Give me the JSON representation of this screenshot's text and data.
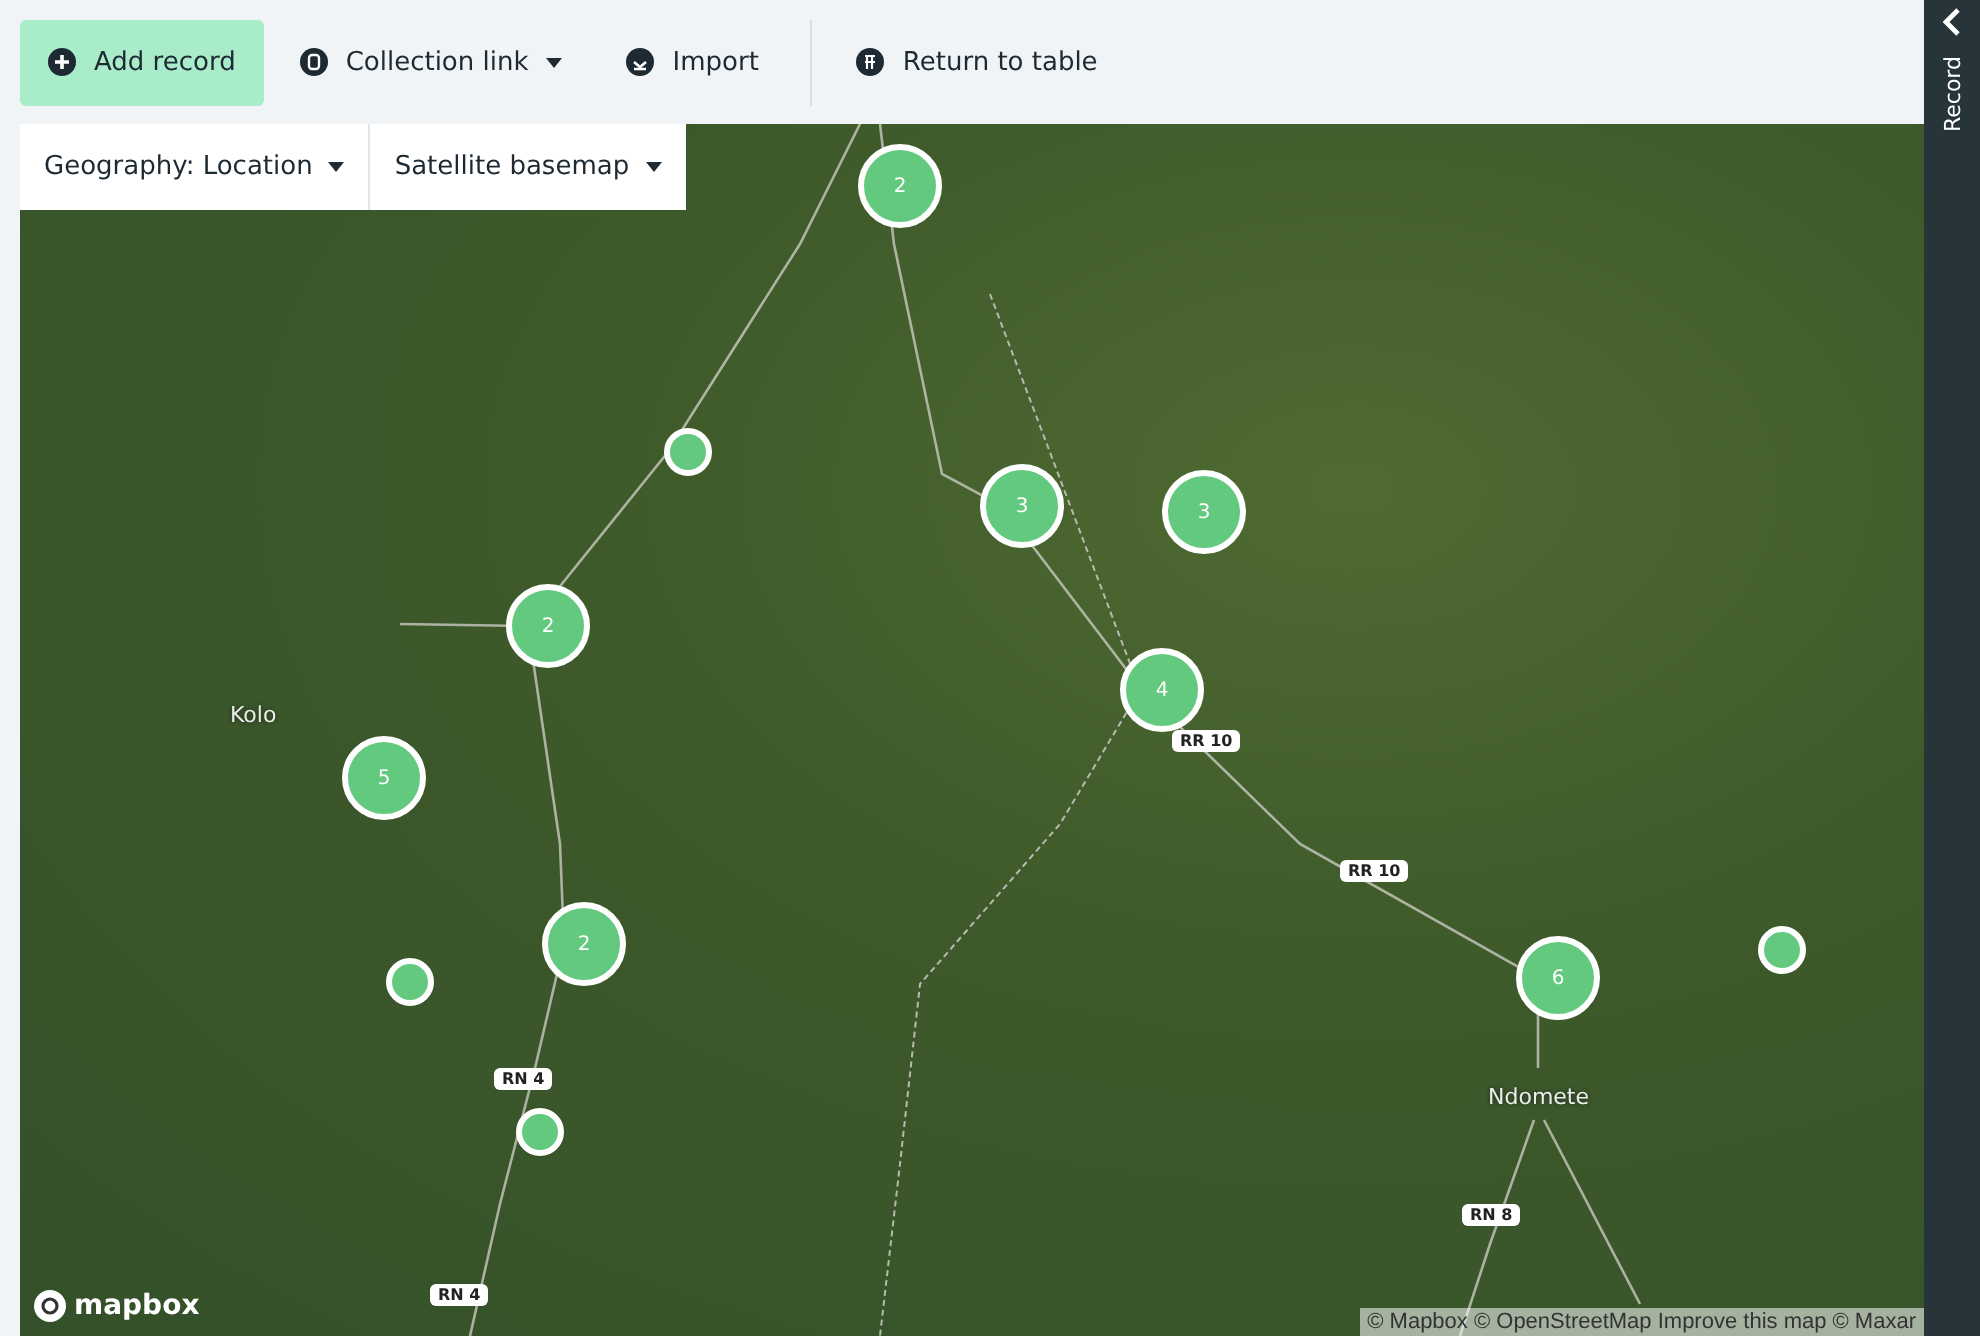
{
  "toolbar": {
    "buttons": [
      {
        "kind": "add",
        "label": "Add record",
        "primary": true,
        "dropdown": false,
        "separated": false
      },
      {
        "kind": "link",
        "label": "Collection link",
        "primary": false,
        "dropdown": true,
        "separated": false
      },
      {
        "kind": "import",
        "label": "Import",
        "primary": false,
        "dropdown": false,
        "separated": false
      },
      {
        "kind": "table",
        "label": "Return to table",
        "primary": false,
        "dropdown": false,
        "separated": true
      }
    ]
  },
  "map_controls": [
    {
      "label": "Geography: Location"
    },
    {
      "label": "Satellite basemap"
    }
  ],
  "map": {
    "places": [
      {
        "label": "Kolo"
      },
      {
        "label": "Ndomete"
      }
    ],
    "road_labels": [
      {
        "label": "RR 10"
      },
      {
        "label": "RR 10"
      },
      {
        "label": "RN 4"
      },
      {
        "label": "RN 8"
      },
      {
        "label": "RN 4"
      }
    ],
    "markers": [
      {
        "kind": "cluster",
        "count": "2"
      },
      {
        "kind": "point"
      },
      {
        "kind": "cluster",
        "count": "3"
      },
      {
        "kind": "cluster",
        "count": "3"
      },
      {
        "kind": "cluster",
        "count": "2"
      },
      {
        "kind": "cluster",
        "count": "4"
      },
      {
        "kind": "cluster",
        "count": "5"
      },
      {
        "kind": "cluster",
        "count": "2"
      },
      {
        "kind": "point"
      },
      {
        "kind": "cluster",
        "count": "6"
      },
      {
        "kind": "point"
      },
      {
        "kind": "point"
      }
    ],
    "logo": "mapbox",
    "attribution": "© Mapbox © OpenStreetMap Improve this map © Maxar"
  },
  "sidebar": {
    "label": "Record",
    "collapsed": true
  }
}
